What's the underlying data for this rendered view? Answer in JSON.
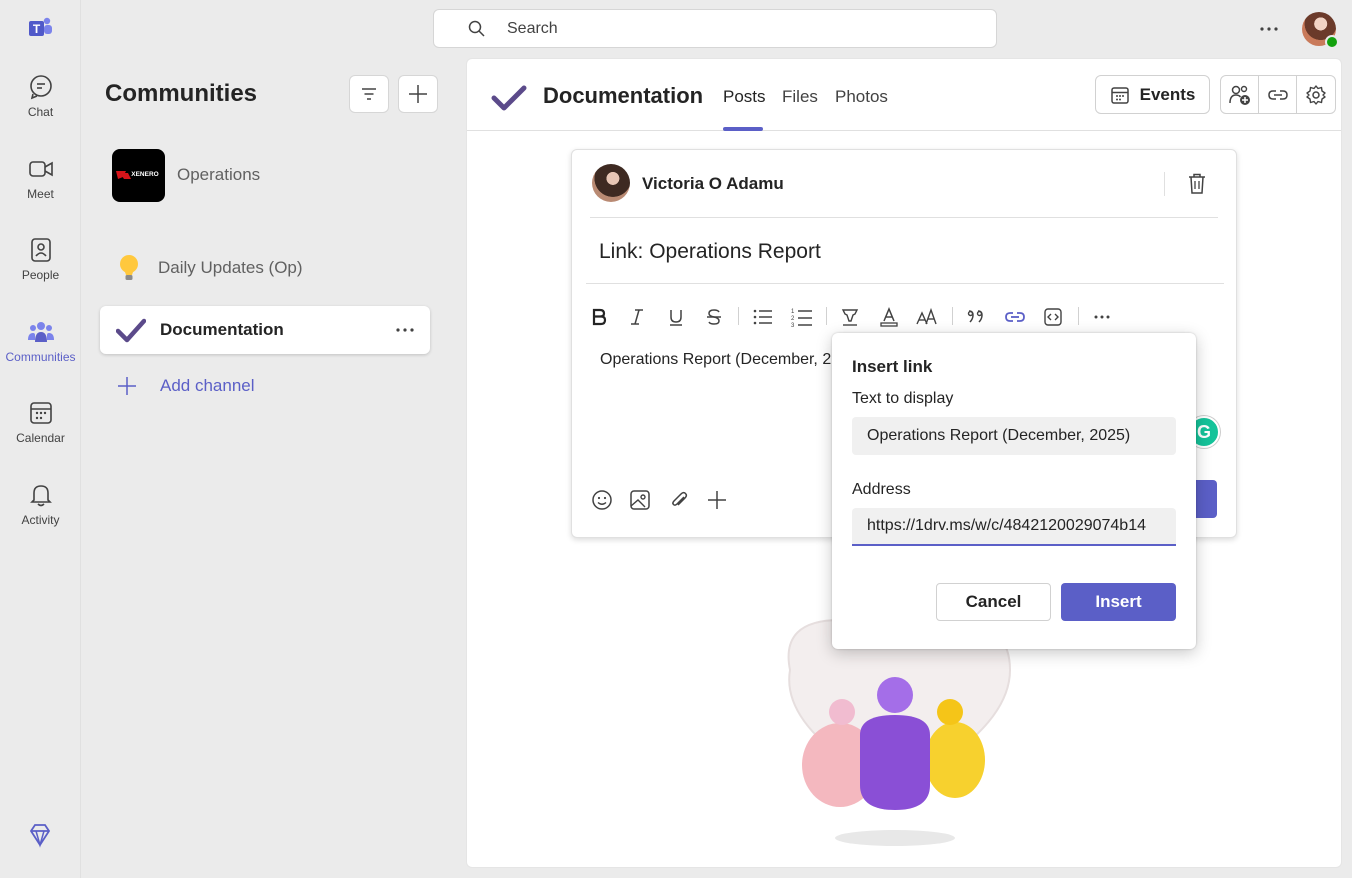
{
  "rail": {
    "items": [
      {
        "label": "Chat",
        "icon": "chat-icon"
      },
      {
        "label": "Meet",
        "icon": "video-icon"
      },
      {
        "label": "People",
        "icon": "people-icon"
      },
      {
        "label": "Communities",
        "icon": "communities-icon",
        "active": true
      },
      {
        "label": "Calendar",
        "icon": "calendar-icon"
      },
      {
        "label": "Activity",
        "icon": "bell-icon"
      }
    ]
  },
  "search": {
    "placeholder": "Search"
  },
  "left_panel": {
    "title": "Communities",
    "community": {
      "name": "Operations",
      "logo_text": "XENERO"
    },
    "channels": [
      {
        "name": "Daily Updates (Op)",
        "icon": "lightbulb-icon"
      },
      {
        "name": "Documentation",
        "icon": "checkmark-icon",
        "selected": true
      }
    ],
    "add_channel": "Add channel"
  },
  "channel_header": {
    "name": "Documentation",
    "tabs": [
      {
        "label": "Posts",
        "active": true
      },
      {
        "label": "Files"
      },
      {
        "label": "Photos"
      }
    ],
    "events_label": "Events"
  },
  "compose": {
    "author": "Victoria O Adamu",
    "subject": "Link: Operations Report",
    "body": "Operations Report (December, 2",
    "grammarly": "G"
  },
  "dialog": {
    "title": "Insert link",
    "text_label": "Text to display",
    "text_value": "Operations Report (December, 2025)",
    "address_label": "Address",
    "address_value": "https://1drv.ms/w/c/4842120029074b14",
    "cancel": "Cancel",
    "insert": "Insert"
  },
  "colors": {
    "accent": "#5b5fc7",
    "status_online": "#13a10e"
  }
}
